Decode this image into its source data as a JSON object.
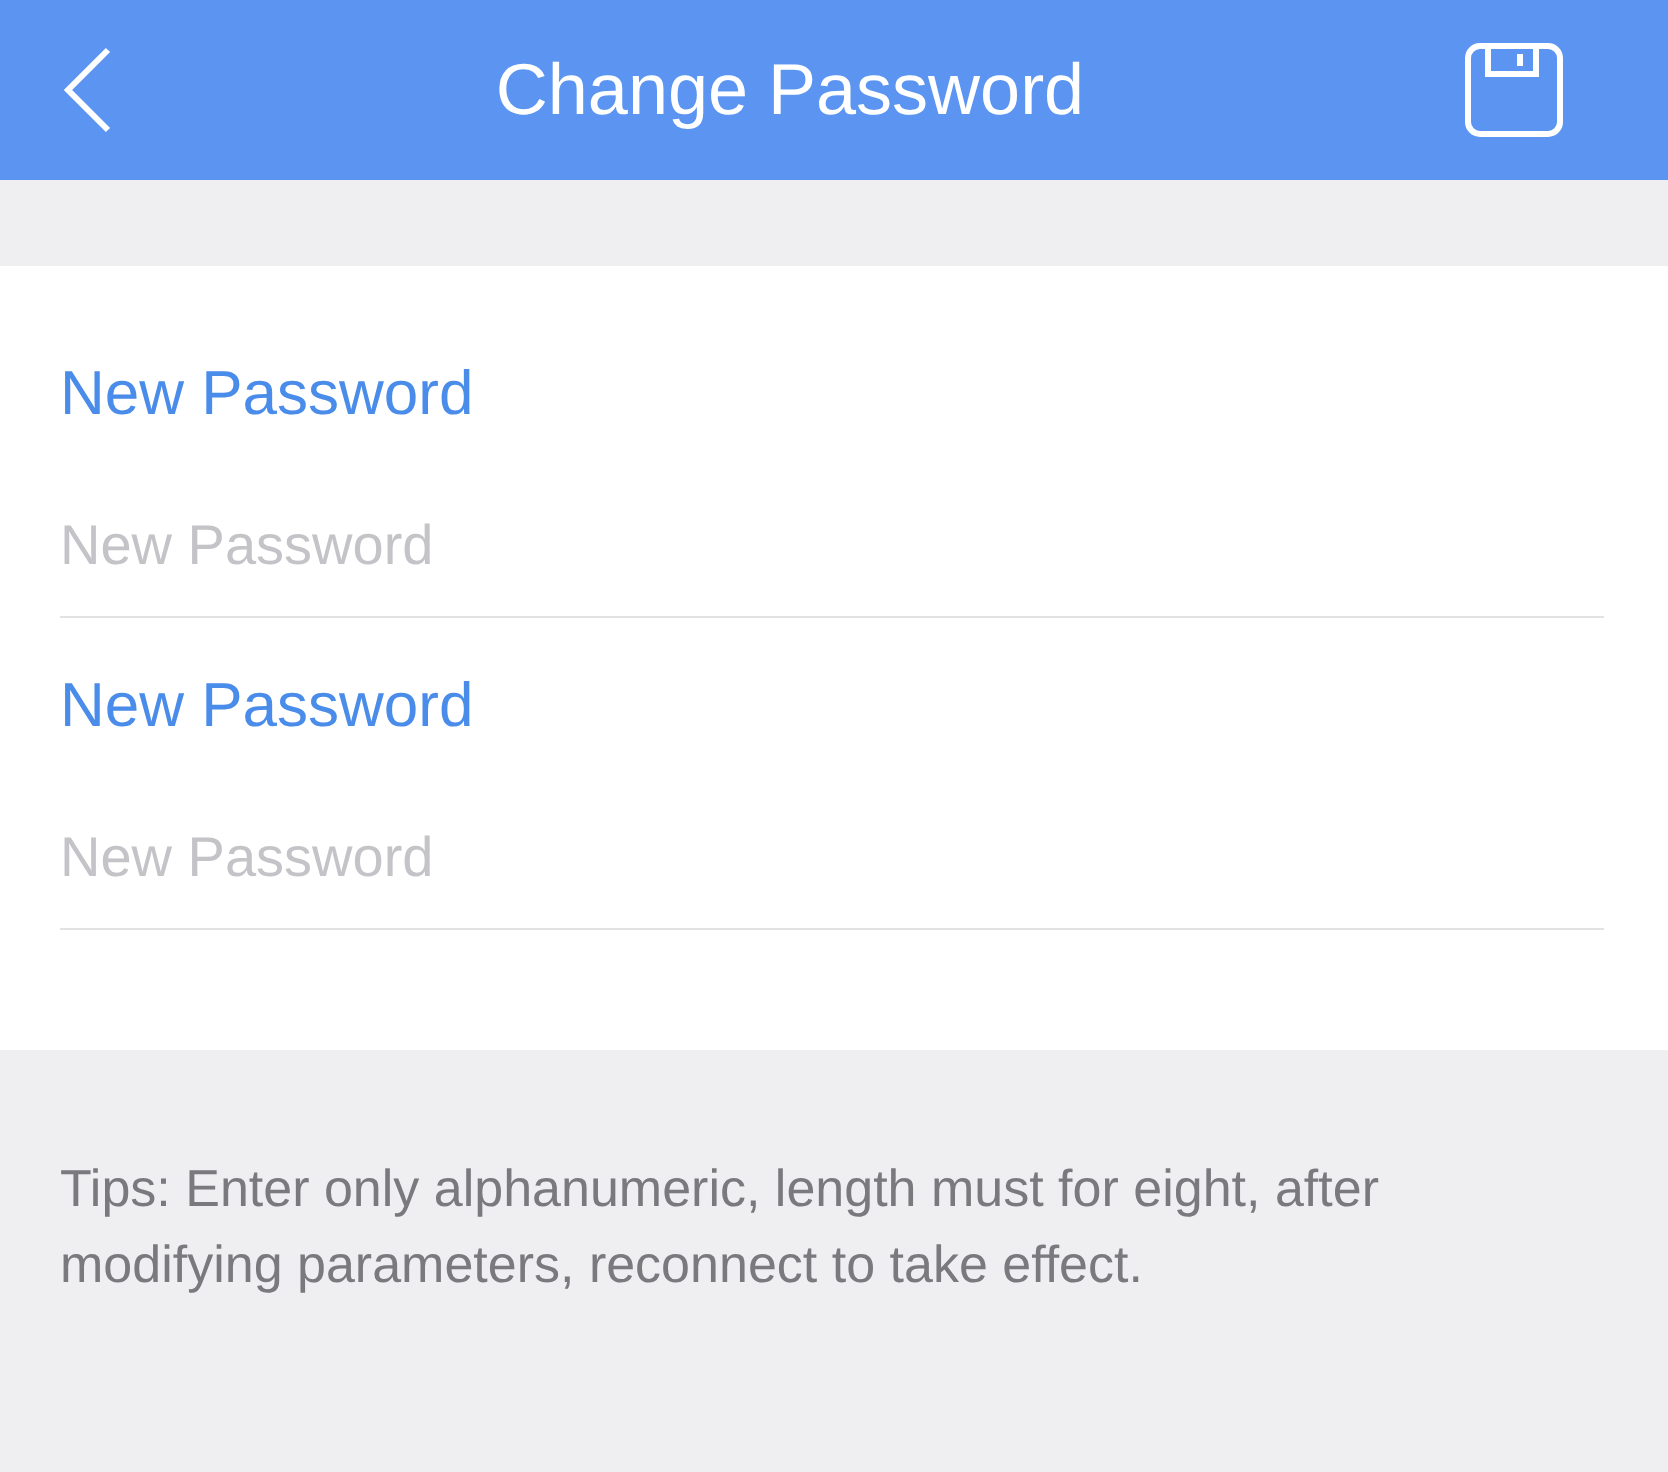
{
  "nav_bar": {
    "title": "Change Password"
  },
  "fields": [
    {
      "label": "New Password",
      "placeholder": "New Password"
    },
    {
      "label": "New Password",
      "placeholder": "New Password"
    }
  ],
  "tips": "Tips: Enter only alphanumeric, length must for eight, after modifying parameters, reconnect to take effect."
}
